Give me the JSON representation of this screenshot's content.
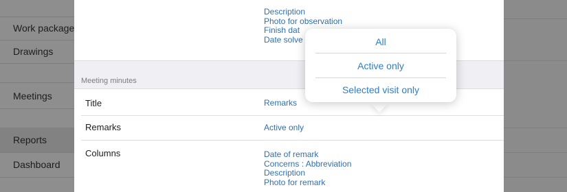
{
  "sidebar": {
    "items": [
      {
        "label": "Work package"
      },
      {
        "label": "Drawings"
      },
      {
        "label": "Meetings"
      },
      {
        "label": "Reports"
      },
      {
        "label": "Dashboard"
      }
    ]
  },
  "top_list": {
    "lines": [
      "Description",
      "Photo for observation",
      "Finish dat",
      "Date solve"
    ]
  },
  "section": {
    "title": "Meeting minutes"
  },
  "rows": {
    "title": {
      "label": "Title",
      "value": "Remarks"
    },
    "remarks": {
      "label": "Remarks",
      "value": "Active only"
    },
    "columns": {
      "label": "Columns",
      "values": [
        "Date of remark",
        "Concerns : Abbreviation",
        "Description",
        "Photo for remark"
      ]
    }
  },
  "popover": {
    "options": [
      "All",
      "Active only",
      "Selected visit only"
    ]
  },
  "colors": {
    "accent": "#2a7fd0",
    "value_text": "#2f6fb0",
    "dim_overlay": "#8e8e8e"
  }
}
